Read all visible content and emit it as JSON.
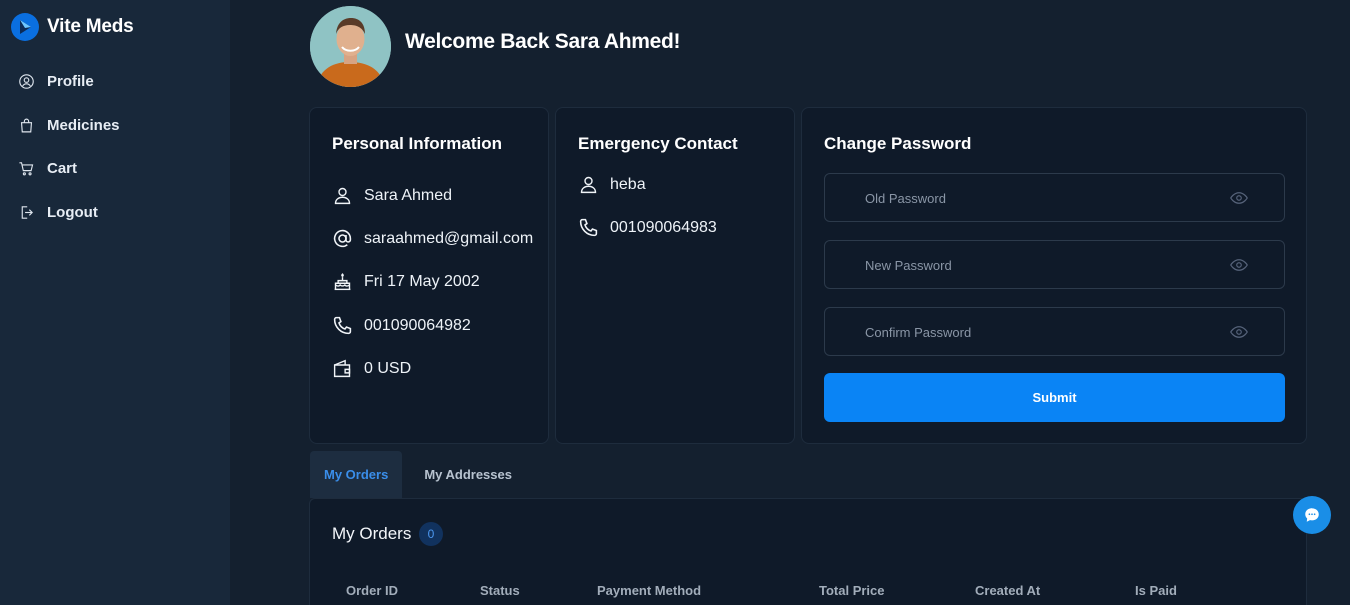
{
  "brand": {
    "name": "Vite Meds",
    "logo_icon": "vite-meds-logo"
  },
  "sidebar": {
    "items": [
      {
        "label": "Profile",
        "icon": "user-circle-icon"
      },
      {
        "label": "Medicines",
        "icon": "shopping-bag-icon"
      },
      {
        "label": "Cart",
        "icon": "cart-icon"
      },
      {
        "label": "Logout",
        "icon": "logout-icon"
      }
    ]
  },
  "header": {
    "welcome": "Welcome Back Sara Ahmed!"
  },
  "personal": {
    "title": "Personal Information",
    "name": "Sara Ahmed",
    "email": "saraahmed@gmail.com",
    "birthday": "Fri 17 May 2002",
    "phone": "001090064982",
    "wallet": "0 USD"
  },
  "emergency": {
    "title": "Emergency Contact",
    "name": "heba",
    "phone": "001090064983"
  },
  "password": {
    "title": "Change Password",
    "old_placeholder": "Old Password",
    "new_placeholder": "New Password",
    "confirm_placeholder": "Confirm Password",
    "submit_label": "Submit"
  },
  "tabs": [
    {
      "label": "My Orders",
      "active": true
    },
    {
      "label": "My Addresses",
      "active": false
    }
  ],
  "orders": {
    "title": "My Orders",
    "count": "0",
    "columns": [
      "Order ID",
      "Status",
      "Payment Method",
      "Total Price",
      "Created At",
      "Is Paid"
    ]
  },
  "colors": {
    "background": "#14202f",
    "sidebar": "#18283a",
    "card": "#0f1a29",
    "accent": "#0a84f5",
    "active_tab_text": "#3a8eea"
  }
}
